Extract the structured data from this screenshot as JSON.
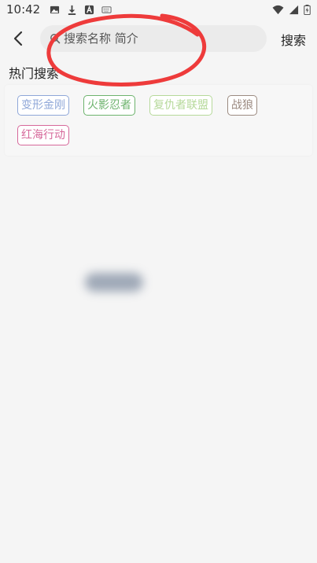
{
  "status_bar": {
    "time": "10:42",
    "left_icons": [
      "image-icon",
      "download-icon",
      "text-icon",
      "keyboard-icon"
    ],
    "right_icons": [
      "wifi-icon",
      "signal-icon",
      "battery-icon"
    ]
  },
  "header": {
    "search_placeholder": "搜索名称 简介",
    "search_button_label": "搜索"
  },
  "hot_search": {
    "title": "热门搜索",
    "tags": [
      {
        "label": "变形金刚",
        "color": "#8fa7d8"
      },
      {
        "label": "火影忍者",
        "color": "#6db36d"
      },
      {
        "label": "复仇者联盟",
        "color": "#b6d99a"
      },
      {
        "label": "战狼",
        "color": "#9b8a80"
      },
      {
        "label": "红海行动",
        "color": "#d6689a"
      }
    ]
  },
  "colors": {
    "background": "#f5f5f5",
    "search_box": "#ebebeb",
    "annotation": "#ee3b3b"
  }
}
